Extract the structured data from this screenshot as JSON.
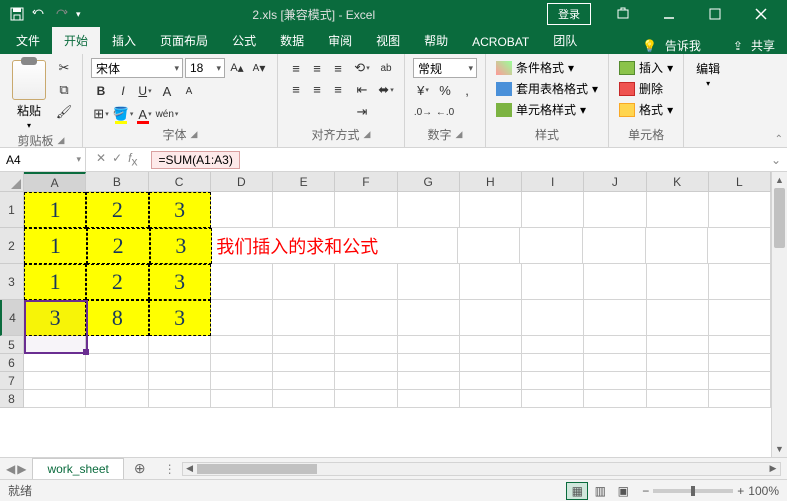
{
  "titlebar": {
    "filename": "2.xls",
    "mode": "[兼容模式]",
    "app": "Excel",
    "login": "登录"
  },
  "tabs": {
    "file": "文件",
    "home": "开始",
    "insert": "插入",
    "layout": "页面布局",
    "formulas": "公式",
    "data": "数据",
    "review": "审阅",
    "view": "视图",
    "help": "帮助",
    "acrobat": "ACROBAT",
    "team": "团队",
    "tellme": "告诉我",
    "share": "共享"
  },
  "ribbon": {
    "clipboard": {
      "paste": "粘贴",
      "label": "剪贴板"
    },
    "font": {
      "name": "宋体",
      "size": "18",
      "label": "字体"
    },
    "align": {
      "wrap": "ab",
      "label": "对齐方式"
    },
    "number": {
      "format": "常规",
      "label": "数字"
    },
    "styles": {
      "cond": "条件格式",
      "table": "套用表格格式",
      "cell": "单元格样式",
      "label": "样式"
    },
    "cells": {
      "insert": "插入",
      "delete": "删除",
      "format": "格式",
      "label": "单元格"
    },
    "editing": {
      "label": "编辑"
    }
  },
  "namebox": "A4",
  "formula": "=SUM(A1:A3)",
  "columns": [
    "A",
    "B",
    "C",
    "D",
    "E",
    "F",
    "G",
    "H",
    "I",
    "J",
    "K",
    "L"
  ],
  "rowlabels": [
    "1",
    "2",
    "3",
    "4",
    "5",
    "6",
    "7",
    "8"
  ],
  "cells": {
    "r1": [
      "1",
      "2",
      "3"
    ],
    "r2": [
      "1",
      "2",
      "3"
    ],
    "r3": [
      "1",
      "2",
      "3"
    ],
    "r4": [
      "3",
      "8",
      "3"
    ]
  },
  "annotation": "我们插入的求和公式",
  "sheet": {
    "name": "work_sheet"
  },
  "status": {
    "ready": "就绪",
    "zoom": "100%"
  },
  "chart_data": {
    "type": "table",
    "columns": [
      "A",
      "B",
      "C"
    ],
    "rows": [
      [
        1,
        2,
        3
      ],
      [
        1,
        2,
        3
      ],
      [
        1,
        2,
        3
      ],
      [
        3,
        8,
        3
      ]
    ],
    "formula_cell": "A4",
    "formula": "=SUM(A1:A3)"
  }
}
